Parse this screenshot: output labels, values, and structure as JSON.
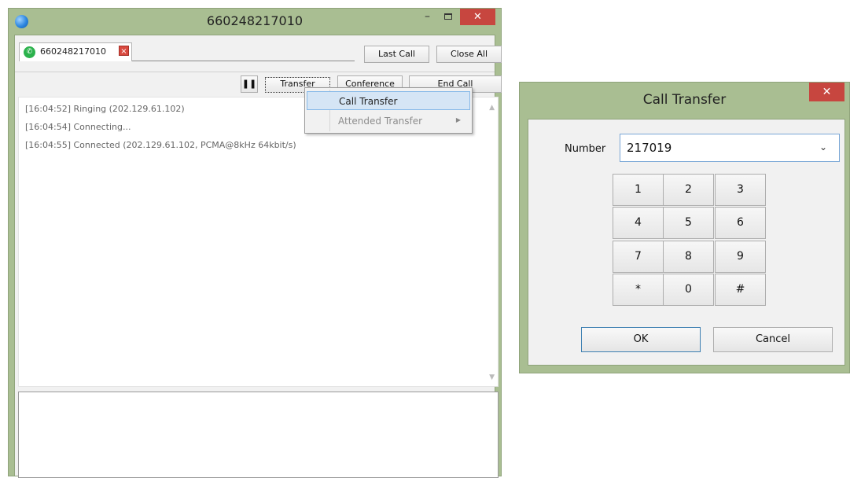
{
  "main_window": {
    "title": "660248217010",
    "minimize_glyph": "–",
    "close_glyph": "✕",
    "tab": {
      "label": "660248217010",
      "close_glyph": "×",
      "icon": "whatsapp-phone-icon"
    },
    "buttons": {
      "last_call": "Last Call",
      "close_all": "Close All",
      "pause": "❚❚",
      "transfer": "Transfer",
      "conference": "Conference",
      "end_call": "End Call"
    },
    "log": [
      "[16:04:52] Ringing (202.129.61.102)",
      "[16:04:54] Connecting...",
      "[16:04:55] Connected (202.129.61.102, PCMA@8kHz 64kbit/s)"
    ],
    "compose_value": ""
  },
  "transfer_menu": {
    "items": [
      {
        "label": "Call Transfer",
        "highlighted": true
      },
      {
        "label": "Attended Transfer",
        "disabled": true,
        "submenu_glyph": "▶"
      }
    ]
  },
  "dialog": {
    "title": "Call Transfer",
    "close_glyph": "✕",
    "number_label": "Number",
    "number_value": "217019",
    "dropdown_glyph": "⌄",
    "keys": [
      "1",
      "2",
      "3",
      "4",
      "5",
      "6",
      "7",
      "8",
      "9",
      "*",
      "0",
      "#"
    ],
    "ok": "OK",
    "cancel": "Cancel"
  },
  "colors": {
    "frame": "#a9be92",
    "close_red": "#c7463f",
    "menu_highlight": "#d5e5f5",
    "focus_blue": "#7aa7d6"
  }
}
